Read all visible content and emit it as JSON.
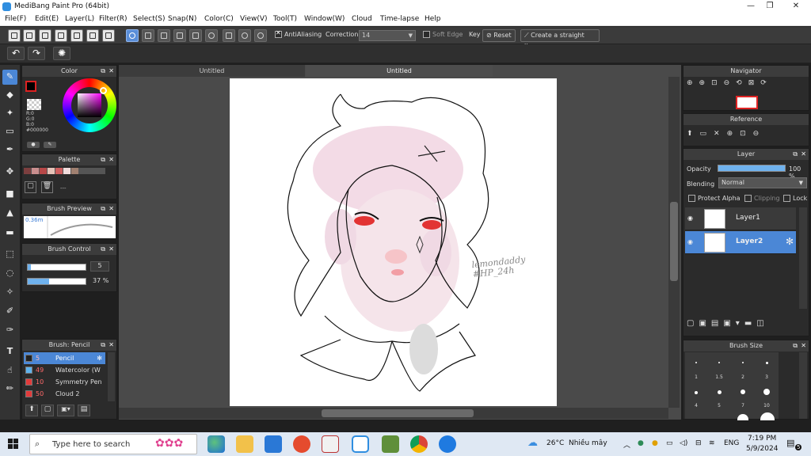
{
  "window": {
    "title": "MediBang Paint Pro (64bit)",
    "minimize": "—",
    "maximize": "❐",
    "close": "✕"
  },
  "menu": [
    "File(F)",
    "Edit(E)",
    "Layer(L)",
    "Filter(R)",
    "Select(S)",
    "Snap(N)",
    "Color(C)",
    "View(V)",
    "Tool(T)",
    "Window(W)",
    "Cloud",
    "Time-lapse",
    "Help"
  ],
  "toolbar": {
    "antialiasing": "AntiAliasing",
    "correction_label": "Correction",
    "correction_value": "14",
    "soft_edge": "Soft Edge",
    "key_label": "Key",
    "reset": "Reset",
    "straight_line": "Create a straight line"
  },
  "color_panel": {
    "title": "Color",
    "r": "R:0",
    "g": "G:0",
    "b": "B:0",
    "hex": "#000000",
    "primary": "#000000",
    "secondary": "#ffffff"
  },
  "palette_panel": {
    "title": "Palette",
    "swatches": [
      "#7c3f3f",
      "#c98e8e",
      "#b84848",
      "#e6c3b8",
      "#cf5f5f",
      "#f1dcdc",
      "#a08070"
    ],
    "separator": "---"
  },
  "brush_preview": {
    "title": "Brush Preview",
    "size": "0.36m"
  },
  "brush_control": {
    "title": "Brush Control",
    "size_value": "5",
    "opacity_value": "37 %",
    "size_fraction": 0.05,
    "opacity_fraction": 0.37
  },
  "brush_list": {
    "title": "Brush: Pencil",
    "items": [
      {
        "num": "5",
        "name": "Pencil",
        "color": "#222222"
      },
      {
        "num": "49",
        "name": "Watercolor (W",
        "color": "#5fb3ee"
      },
      {
        "num": "10",
        "name": "Symmetry Pen",
        "color": "#e23b3b"
      },
      {
        "num": "50",
        "name": "Cloud 2",
        "color": "#e23b3b"
      }
    ]
  },
  "canvas": {
    "tab1": "Untitled",
    "tab2": "Untitled",
    "signature": "lemondaddy #HP_24h"
  },
  "navigator": {
    "title": "Navigator"
  },
  "reference": {
    "title": "Reference"
  },
  "layer_panel": {
    "title": "Layer",
    "opacity_label": "Opacity",
    "opacity_value": "100 %",
    "opacity_fraction": 1.0,
    "blending_label": "Blending",
    "blending_value": "Normal",
    "protect_alpha": "Protect Alpha",
    "clipping": "Clipping",
    "lock": "Lock",
    "layers": [
      {
        "name": "Layer1",
        "selected": false
      },
      {
        "name": "Layer2",
        "selected": true
      }
    ]
  },
  "brush_size": {
    "title": "Brush Size",
    "labels": [
      "1",
      "1.5",
      "2",
      "3",
      "4",
      "5",
      "7",
      "10"
    ]
  },
  "taskbar": {
    "search_placeholder": "Type here to search",
    "weather_temp": "26°C",
    "weather_desc": "Nhiều mây",
    "lang": "ENG",
    "time": "7:19 PM",
    "date": "5/9/2024",
    "notif_count": "5"
  }
}
